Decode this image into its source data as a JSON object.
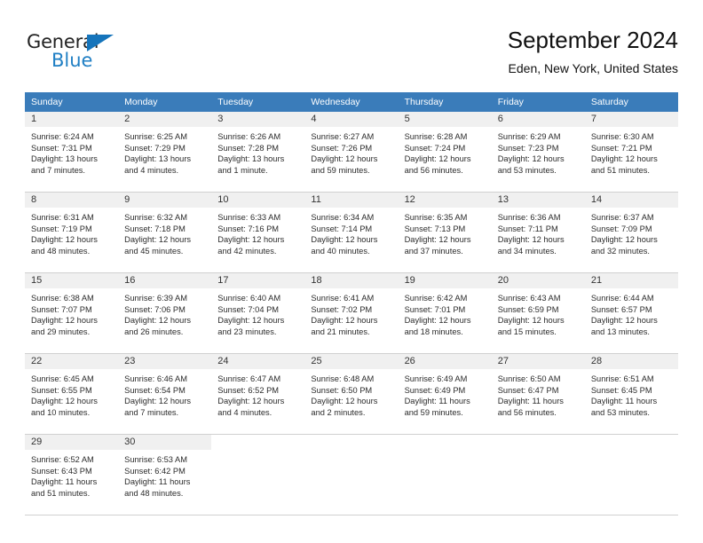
{
  "logo": {
    "word_one": "General",
    "word_two": "Blue",
    "triangle_color": "#1574bb",
    "blue_color": "#1f7fc4"
  },
  "header": {
    "title": "September 2024",
    "subtitle": "Eden, New York, United States"
  },
  "theme": {
    "header_blue": "#3a7cba",
    "daynum_band": "#f0f0f0",
    "grid_line": "#d0d0d0"
  },
  "calendar": {
    "day_headers": [
      "Sunday",
      "Monday",
      "Tuesday",
      "Wednesday",
      "Thursday",
      "Friday",
      "Saturday"
    ],
    "weeks": [
      [
        {
          "day": "1",
          "sunrise": "Sunrise: 6:24 AM",
          "sunset": "Sunset: 7:31 PM",
          "daylight_line1": "Daylight: 13 hours",
          "daylight_line2": "and 7 minutes."
        },
        {
          "day": "2",
          "sunrise": "Sunrise: 6:25 AM",
          "sunset": "Sunset: 7:29 PM",
          "daylight_line1": "Daylight: 13 hours",
          "daylight_line2": "and 4 minutes."
        },
        {
          "day": "3",
          "sunrise": "Sunrise: 6:26 AM",
          "sunset": "Sunset: 7:28 PM",
          "daylight_line1": "Daylight: 13 hours",
          "daylight_line2": "and 1 minute."
        },
        {
          "day": "4",
          "sunrise": "Sunrise: 6:27 AM",
          "sunset": "Sunset: 7:26 PM",
          "daylight_line1": "Daylight: 12 hours",
          "daylight_line2": "and 59 minutes."
        },
        {
          "day": "5",
          "sunrise": "Sunrise: 6:28 AM",
          "sunset": "Sunset: 7:24 PM",
          "daylight_line1": "Daylight: 12 hours",
          "daylight_line2": "and 56 minutes."
        },
        {
          "day": "6",
          "sunrise": "Sunrise: 6:29 AM",
          "sunset": "Sunset: 7:23 PM",
          "daylight_line1": "Daylight: 12 hours",
          "daylight_line2": "and 53 minutes."
        },
        {
          "day": "7",
          "sunrise": "Sunrise: 6:30 AM",
          "sunset": "Sunset: 7:21 PM",
          "daylight_line1": "Daylight: 12 hours",
          "daylight_line2": "and 51 minutes."
        }
      ],
      [
        {
          "day": "8",
          "sunrise": "Sunrise: 6:31 AM",
          "sunset": "Sunset: 7:19 PM",
          "daylight_line1": "Daylight: 12 hours",
          "daylight_line2": "and 48 minutes."
        },
        {
          "day": "9",
          "sunrise": "Sunrise: 6:32 AM",
          "sunset": "Sunset: 7:18 PM",
          "daylight_line1": "Daylight: 12 hours",
          "daylight_line2": "and 45 minutes."
        },
        {
          "day": "10",
          "sunrise": "Sunrise: 6:33 AM",
          "sunset": "Sunset: 7:16 PM",
          "daylight_line1": "Daylight: 12 hours",
          "daylight_line2": "and 42 minutes."
        },
        {
          "day": "11",
          "sunrise": "Sunrise: 6:34 AM",
          "sunset": "Sunset: 7:14 PM",
          "daylight_line1": "Daylight: 12 hours",
          "daylight_line2": "and 40 minutes."
        },
        {
          "day": "12",
          "sunrise": "Sunrise: 6:35 AM",
          "sunset": "Sunset: 7:13 PM",
          "daylight_line1": "Daylight: 12 hours",
          "daylight_line2": "and 37 minutes."
        },
        {
          "day": "13",
          "sunrise": "Sunrise: 6:36 AM",
          "sunset": "Sunset: 7:11 PM",
          "daylight_line1": "Daylight: 12 hours",
          "daylight_line2": "and 34 minutes."
        },
        {
          "day": "14",
          "sunrise": "Sunrise: 6:37 AM",
          "sunset": "Sunset: 7:09 PM",
          "daylight_line1": "Daylight: 12 hours",
          "daylight_line2": "and 32 minutes."
        }
      ],
      [
        {
          "day": "15",
          "sunrise": "Sunrise: 6:38 AM",
          "sunset": "Sunset: 7:07 PM",
          "daylight_line1": "Daylight: 12 hours",
          "daylight_line2": "and 29 minutes."
        },
        {
          "day": "16",
          "sunrise": "Sunrise: 6:39 AM",
          "sunset": "Sunset: 7:06 PM",
          "daylight_line1": "Daylight: 12 hours",
          "daylight_line2": "and 26 minutes."
        },
        {
          "day": "17",
          "sunrise": "Sunrise: 6:40 AM",
          "sunset": "Sunset: 7:04 PM",
          "daylight_line1": "Daylight: 12 hours",
          "daylight_line2": "and 23 minutes."
        },
        {
          "day": "18",
          "sunrise": "Sunrise: 6:41 AM",
          "sunset": "Sunset: 7:02 PM",
          "daylight_line1": "Daylight: 12 hours",
          "daylight_line2": "and 21 minutes."
        },
        {
          "day": "19",
          "sunrise": "Sunrise: 6:42 AM",
          "sunset": "Sunset: 7:01 PM",
          "daylight_line1": "Daylight: 12 hours",
          "daylight_line2": "and 18 minutes."
        },
        {
          "day": "20",
          "sunrise": "Sunrise: 6:43 AM",
          "sunset": "Sunset: 6:59 PM",
          "daylight_line1": "Daylight: 12 hours",
          "daylight_line2": "and 15 minutes."
        },
        {
          "day": "21",
          "sunrise": "Sunrise: 6:44 AM",
          "sunset": "Sunset: 6:57 PM",
          "daylight_line1": "Daylight: 12 hours",
          "daylight_line2": "and 13 minutes."
        }
      ],
      [
        {
          "day": "22",
          "sunrise": "Sunrise: 6:45 AM",
          "sunset": "Sunset: 6:55 PM",
          "daylight_line1": "Daylight: 12 hours",
          "daylight_line2": "and 10 minutes."
        },
        {
          "day": "23",
          "sunrise": "Sunrise: 6:46 AM",
          "sunset": "Sunset: 6:54 PM",
          "daylight_line1": "Daylight: 12 hours",
          "daylight_line2": "and 7 minutes."
        },
        {
          "day": "24",
          "sunrise": "Sunrise: 6:47 AM",
          "sunset": "Sunset: 6:52 PM",
          "daylight_line1": "Daylight: 12 hours",
          "daylight_line2": "and 4 minutes."
        },
        {
          "day": "25",
          "sunrise": "Sunrise: 6:48 AM",
          "sunset": "Sunset: 6:50 PM",
          "daylight_line1": "Daylight: 12 hours",
          "daylight_line2": "and 2 minutes."
        },
        {
          "day": "26",
          "sunrise": "Sunrise: 6:49 AM",
          "sunset": "Sunset: 6:49 PM",
          "daylight_line1": "Daylight: 11 hours",
          "daylight_line2": "and 59 minutes."
        },
        {
          "day": "27",
          "sunrise": "Sunrise: 6:50 AM",
          "sunset": "Sunset: 6:47 PM",
          "daylight_line1": "Daylight: 11 hours",
          "daylight_line2": "and 56 minutes."
        },
        {
          "day": "28",
          "sunrise": "Sunrise: 6:51 AM",
          "sunset": "Sunset: 6:45 PM",
          "daylight_line1": "Daylight: 11 hours",
          "daylight_line2": "and 53 minutes."
        }
      ],
      [
        {
          "day": "29",
          "sunrise": "Sunrise: 6:52 AM",
          "sunset": "Sunset: 6:43 PM",
          "daylight_line1": "Daylight: 11 hours",
          "daylight_line2": "and 51 minutes."
        },
        {
          "day": "30",
          "sunrise": "Sunrise: 6:53 AM",
          "sunset": "Sunset: 6:42 PM",
          "daylight_line1": "Daylight: 11 hours",
          "daylight_line2": "and 48 minutes."
        },
        {
          "day": "",
          "sunrise": "",
          "sunset": "",
          "daylight_line1": "",
          "daylight_line2": ""
        },
        {
          "day": "",
          "sunrise": "",
          "sunset": "",
          "daylight_line1": "",
          "daylight_line2": ""
        },
        {
          "day": "",
          "sunrise": "",
          "sunset": "",
          "daylight_line1": "",
          "daylight_line2": ""
        },
        {
          "day": "",
          "sunrise": "",
          "sunset": "",
          "daylight_line1": "",
          "daylight_line2": ""
        },
        {
          "day": "",
          "sunrise": "",
          "sunset": "",
          "daylight_line1": "",
          "daylight_line2": ""
        }
      ]
    ]
  }
}
